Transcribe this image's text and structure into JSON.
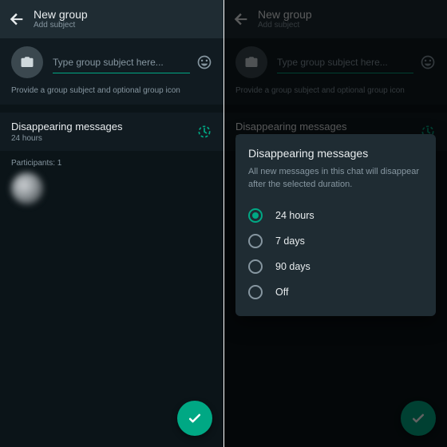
{
  "accent": "#00a884",
  "left": {
    "title": "New group",
    "subtitle": "Add subject",
    "placeholder": "Type group subject here...",
    "hint": "Provide a group subject and optional group icon",
    "dm_title": "Disappearing messages",
    "dm_value": "24 hours",
    "participants_label": "Participants: 1"
  },
  "right": {
    "title": "New group",
    "subtitle": "Add subject",
    "placeholder": "Type group subject here...",
    "hint": "Provide a group subject and optional group icon",
    "dm_title": "Disappearing messages",
    "dm_value": "24 hours",
    "dialog_title": "Disappearing messages",
    "dialog_desc": "All new messages in this chat will disappear after the selected duration.",
    "options": [
      "24 hours",
      "7 days",
      "90 days",
      "Off"
    ],
    "selected": "24 hours"
  }
}
